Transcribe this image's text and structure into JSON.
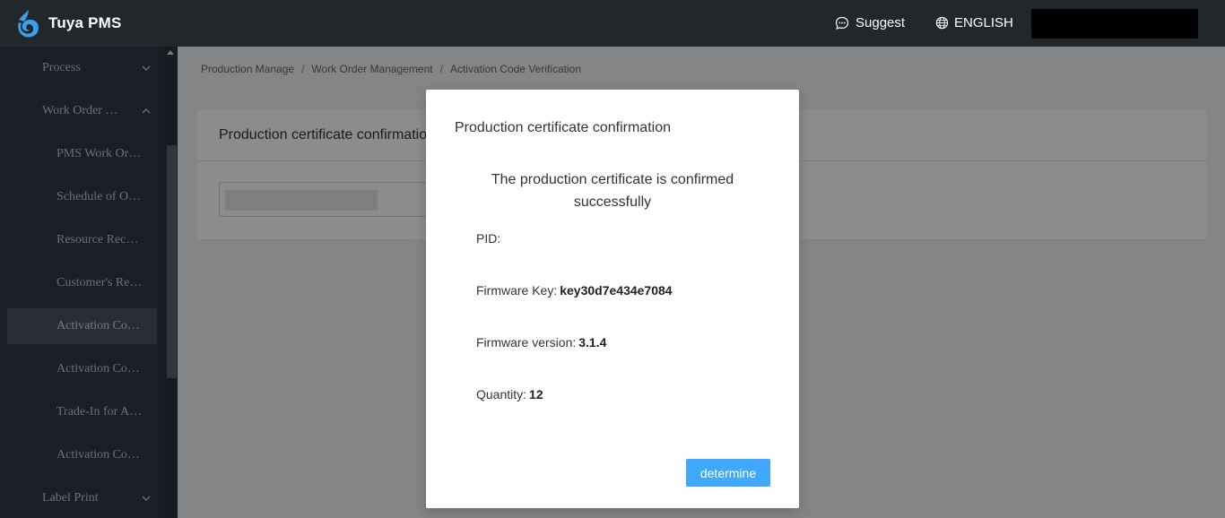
{
  "header": {
    "app_name": "Tuya PMS",
    "suggest_label": "Suggest",
    "language_label": "ENGLISH"
  },
  "sidebar": {
    "items": [
      {
        "label": "Process",
        "level": 1,
        "chevron": "down"
      },
      {
        "label": "Work Order …",
        "level": 1,
        "chevron": "up"
      },
      {
        "label": "PMS Work Or…",
        "level": 2
      },
      {
        "label": "Schedule of O…",
        "level": 2
      },
      {
        "label": "Resource Rec…",
        "level": 2
      },
      {
        "label": "Customer's Re…",
        "level": 2
      },
      {
        "label": "Activation Co…",
        "level": 2,
        "active": true
      },
      {
        "label": "Activation Co…",
        "level": 2
      },
      {
        "label": "Trade-In for A…",
        "level": 2
      },
      {
        "label": "Activation Co…",
        "level": 2
      },
      {
        "label": "Label Print",
        "level": 1,
        "chevron": "down"
      }
    ]
  },
  "breadcrumb": {
    "items": [
      "Production Manage",
      "Work Order Management",
      "Activation Code Verification"
    ],
    "separator": "/"
  },
  "card": {
    "title": "Production certificate confirmatio"
  },
  "modal": {
    "title": "Production certificate confirmation",
    "message": "The production certificate is confirmed successfully",
    "fields": {
      "pid": {
        "label": "PID:",
        "value": ""
      },
      "firmware_key": {
        "label": "Firmware Key:",
        "value": "key30d7e434e7084"
      },
      "firmware_version": {
        "label": "Firmware version:",
        "value": "3.1.4"
      },
      "quantity": {
        "label": "Quantity:",
        "value": "12"
      }
    },
    "confirm_button": "determine"
  },
  "colors": {
    "topbar": "#22272c",
    "sidebar": "#313a45",
    "primary_button": "#40a9ff"
  },
  "icons": [
    "tuya-logo-icon",
    "chat-bubble-icon",
    "globe-icon",
    "chevron-down-icon",
    "chevron-up-icon",
    "scroll-up-arrow-icon"
  ]
}
